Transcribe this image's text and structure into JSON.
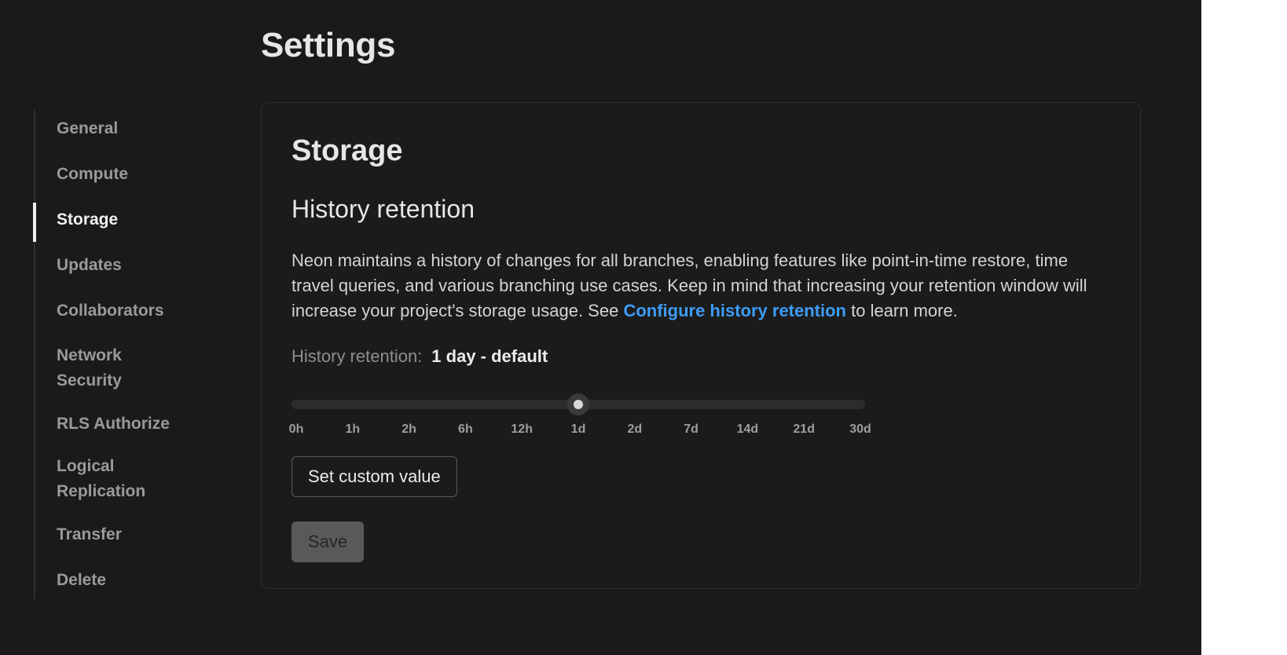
{
  "page": {
    "title": "Settings"
  },
  "sidebar": {
    "active_index": 2,
    "items": [
      {
        "label": "General"
      },
      {
        "label": "Compute"
      },
      {
        "label": "Storage"
      },
      {
        "label": "Updates"
      },
      {
        "label": "Collaborators"
      },
      {
        "label": "Network\nSecurity"
      },
      {
        "label": "RLS Authorize"
      },
      {
        "label": "Logical\nReplication"
      },
      {
        "label": "Transfer"
      },
      {
        "label": "Delete"
      }
    ]
  },
  "card": {
    "title": "Storage",
    "section_title": "History retention",
    "description_before_link": "Neon maintains a history of changes for all branches, enabling features like point-in-time restore, time travel queries, and various branching use cases. Keep in mind that increasing your retention window will increase your project's storage usage. See ",
    "link_text": "Configure history retention",
    "description_after_link": " to learn more.",
    "retention_label": "History retention:",
    "retention_value": "1 day - default"
  },
  "slider": {
    "ticks": [
      "0h",
      "1h",
      "2h",
      "6h",
      "12h",
      "1d",
      "2d",
      "7d",
      "14d",
      "21d",
      "30d"
    ],
    "selected_index": 5
  },
  "buttons": {
    "custom_label": "Set custom value",
    "save_label": "Save"
  },
  "colors": {
    "background": "#1a1a1a",
    "link": "#3d9cf5",
    "active_nav": "#f0f0f0",
    "inactive_nav": "#9a9a9a"
  }
}
